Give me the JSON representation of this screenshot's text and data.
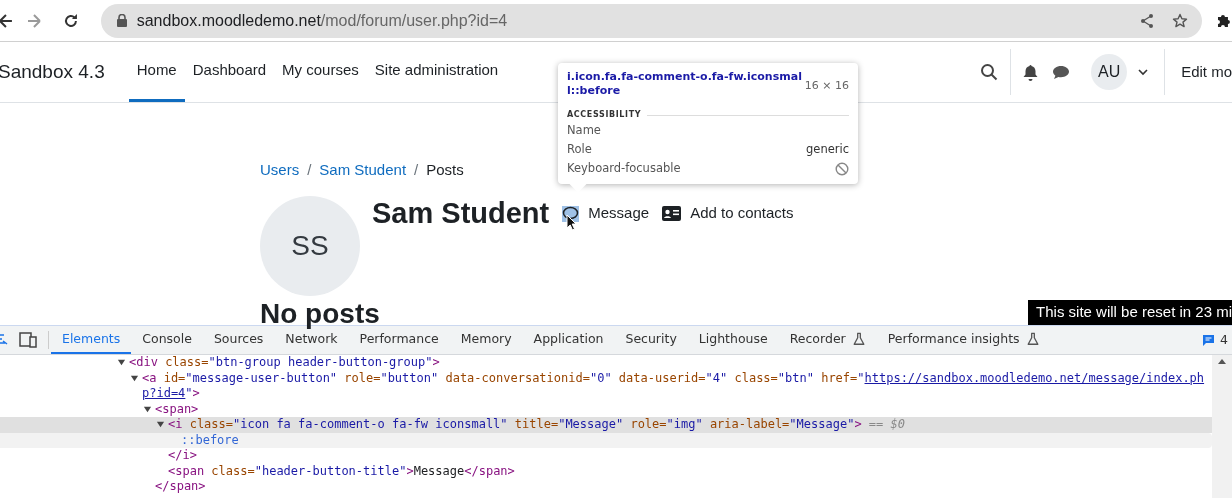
{
  "browser": {
    "url_domain": "sandbox.moodledemo.net",
    "url_path": "/mod/forum/user.php?id=4",
    "forward_disabled": true
  },
  "nav": {
    "brand": "Sandbox 4.3",
    "items": [
      {
        "label": "Home",
        "selected": true
      },
      {
        "label": "Dashboard",
        "selected": false
      },
      {
        "label": "My courses",
        "selected": false
      },
      {
        "label": "Site administration",
        "selected": false
      }
    ],
    "avatar": "AU",
    "edit_mode": "Edit mo"
  },
  "breadcrumb": [
    {
      "label": "Users",
      "kind": "link"
    },
    {
      "separator": "/",
      "label": "Sam Student",
      "kind": "link"
    },
    {
      "separator": "/",
      "label": "Posts",
      "kind": "current"
    }
  ],
  "profile": {
    "initials": "SS",
    "name": "Sam Student",
    "actions": [
      {
        "label": "Message",
        "kind": "message",
        "highlighted": true
      },
      {
        "label": "Add to contacts",
        "kind": "contact",
        "highlighted": false
      }
    ]
  },
  "heading": "No posts",
  "reset_notice": "This site will be reset in 23 mi",
  "tooltip": {
    "selector_lines": [
      "i.icon.fa.fa-comment-o.fa-fw.iconsmal",
      "l::before"
    ],
    "size": "16 × 16",
    "section": "ACCESSIBILITY",
    "rows": [
      {
        "label": "Name",
        "kind": "text"
      },
      {
        "label": "Role",
        "kind": "text",
        "value": "generic"
      },
      {
        "label": "Keyboard-focusable",
        "kind": "flag",
        "on": false
      }
    ]
  },
  "devtools": {
    "tabs": [
      {
        "label": "Elements",
        "selected": true,
        "experimental": false
      },
      {
        "label": "Console",
        "selected": false,
        "experimental": false
      },
      {
        "label": "Sources",
        "selected": false,
        "experimental": false
      },
      {
        "label": "Network",
        "selected": false,
        "experimental": false
      },
      {
        "label": "Performance",
        "selected": false,
        "experimental": false
      },
      {
        "label": "Memory",
        "selected": false,
        "experimental": false
      },
      {
        "label": "Application",
        "selected": false,
        "experimental": false
      },
      {
        "label": "Security",
        "selected": false,
        "experimental": false
      },
      {
        "label": "Lighthouse",
        "selected": false,
        "experimental": false
      },
      {
        "label": "Recorder",
        "selected": false,
        "experimental": true
      },
      {
        "label": "Performance insights",
        "selected": false,
        "experimental": true
      }
    ],
    "issues": "4",
    "dom": [
      {
        "expanded": true,
        "selected": false,
        "hovered": false,
        "tokens": [
          {
            "kind": "tag",
            "t": "<div"
          },
          {
            "kind": "attr",
            "t": "class="
          },
          {
            "kind": "value",
            "t": "\"btn-group header-button-group\""
          },
          {
            "kind": "tag",
            "t": ">"
          }
        ],
        "children": [
          {
            "expanded": true,
            "selected": false,
            "hovered": false,
            "tokens": [
              {
                "kind": "tag",
                "t": "<a"
              },
              {
                "kind": "attr",
                "t": "id="
              },
              {
                "kind": "value",
                "t": "\"message-user-button\""
              },
              {
                "kind": "attr",
                "t": "role="
              },
              {
                "kind": "value",
                "t": "\"button\""
              },
              {
                "kind": "attr",
                "t": "data-conversationid="
              },
              {
                "kind": "value",
                "t": "\"0\""
              },
              {
                "kind": "attr",
                "t": "data-userid="
              },
              {
                "kind": "value",
                "t": "\"4\""
              },
              {
                "kind": "attr",
                "t": "class="
              },
              {
                "kind": "value",
                "t": "\"btn\""
              },
              {
                "kind": "attr",
                "t": "href="
              },
              {
                "kind": "value",
                "t": "\""
              },
              {
                "kind": "link",
                "t": "https://sandbox.moodledemo.net/message/index.ph"
              }
            ],
            "continuation": [
              {
                "kind": "link",
                "t": "p?id=4"
              },
              {
                "kind": "value",
                "t": "\""
              },
              {
                "kind": "tag",
                "t": ">"
              }
            ],
            "children": [
              {
                "expanded": true,
                "selected": false,
                "hovered": false,
                "tokens": [
                  {
                    "kind": "tag",
                    "t": "<span>"
                  }
                ],
                "children": [
                  {
                    "expanded": true,
                    "selected": true,
                    "hovered": false,
                    "tokens": [
                      {
                        "kind": "tag",
                        "t": "<i"
                      },
                      {
                        "kind": "attr",
                        "t": "class="
                      },
                      {
                        "kind": "value",
                        "t": "\"icon fa fa-comment-o fa-fw iconsmall\""
                      },
                      {
                        "kind": "attr",
                        "t": "title="
                      },
                      {
                        "kind": "value",
                        "t": "\"Message\""
                      },
                      {
                        "kind": "attr",
                        "t": "role="
                      },
                      {
                        "kind": "value",
                        "t": "\"img\""
                      },
                      {
                        "kind": "attr",
                        "t": "aria-label="
                      },
                      {
                        "kind": "value",
                        "t": "\"Message\""
                      },
                      {
                        "kind": "tag",
                        "t": ">"
                      },
                      {
                        "kind": "dim",
                        "t": "== $0"
                      }
                    ],
                    "children": [
                      {
                        "selected": false,
                        "hovered": true,
                        "tokens": [
                          {
                            "kind": "pseudo",
                            "t": "::before"
                          }
                        ]
                      }
                    ],
                    "close": [
                      {
                        "kind": "tag",
                        "t": "</i>"
                      }
                    ]
                  },
                  {
                    "selected": false,
                    "hovered": false,
                    "tokens": [
                      {
                        "kind": "tag",
                        "t": "<span"
                      },
                      {
                        "kind": "attr",
                        "t": "class="
                      },
                      {
                        "kind": "value",
                        "t": "\"header-button-title\""
                      },
                      {
                        "kind": "tag",
                        "t": ">"
                      },
                      {
                        "kind": "text",
                        "t": "Message"
                      },
                      {
                        "kind": "tag",
                        "t": "</span>"
                      }
                    ]
                  }
                ],
                "close": [
                  {
                    "kind": "tag",
                    "t": "</span>"
                  }
                ]
              }
            ]
          }
        ]
      }
    ]
  }
}
